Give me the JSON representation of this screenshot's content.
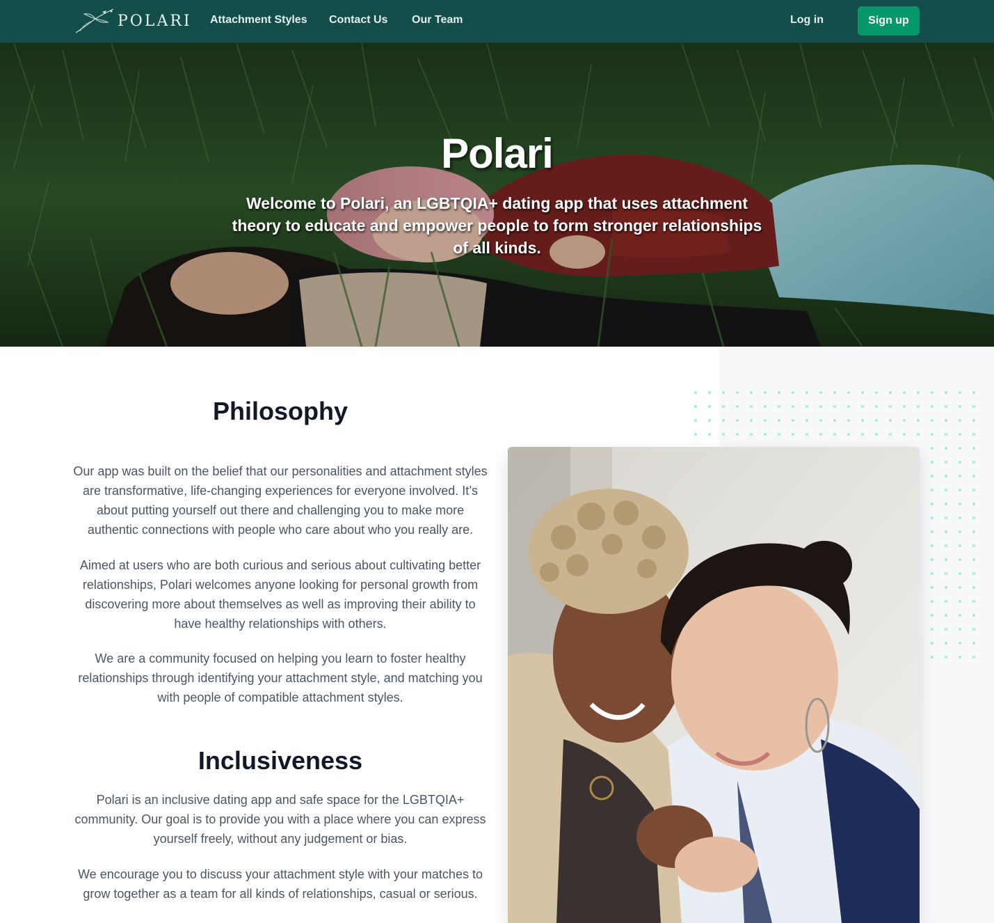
{
  "nav": {
    "logo_text": "POLARI",
    "links": [
      "Attachment Styles",
      "Contact Us",
      "Our Team"
    ],
    "login": "Log in",
    "signup": "Sign up"
  },
  "hero": {
    "title": "Polari",
    "subtitle": "Welcome to Polari, an LGBTQIA+ dating app that uses attachment theory to educate and empower people to form stronger relationships of all kinds."
  },
  "philosophy": {
    "heading": "Philosophy",
    "paragraphs": [
      "Our app was built on the belief that our personalities and attachment styles are transformative, life-changing experiences for everyone involved. It’s about putting yourself out there and challenging you to make more authentic connections with people who care about who you really are.",
      "Aimed at users who are both curious and serious about cultivating better relationships, Polari welcomes anyone looking for personal growth from discovering more about themselves as well as improving their ability to have healthy relationships with others.",
      "We are a community focused on helping you learn to foster healthy relationships through identifying your attachment style, and matching you with people of compatible attachment styles."
    ]
  },
  "inclusiveness": {
    "heading": "Inclusiveness",
    "paragraphs": [
      "Polari is an inclusive dating app and safe space for the LGBTQIA+ community. Our goal is to provide you with a place where you can express yourself freely, without any judgement or bias.",
      "We encourage you to discuss your attachment style with your matches to grow together as a team for all kinds of relationships, casual or serious."
    ]
  },
  "colors": {
    "nav_bg": "#134e4a",
    "signup_bg": "#059669",
    "heading": "#111827",
    "body_text": "#4b5563",
    "dot_pattern": "#99e6d6"
  }
}
